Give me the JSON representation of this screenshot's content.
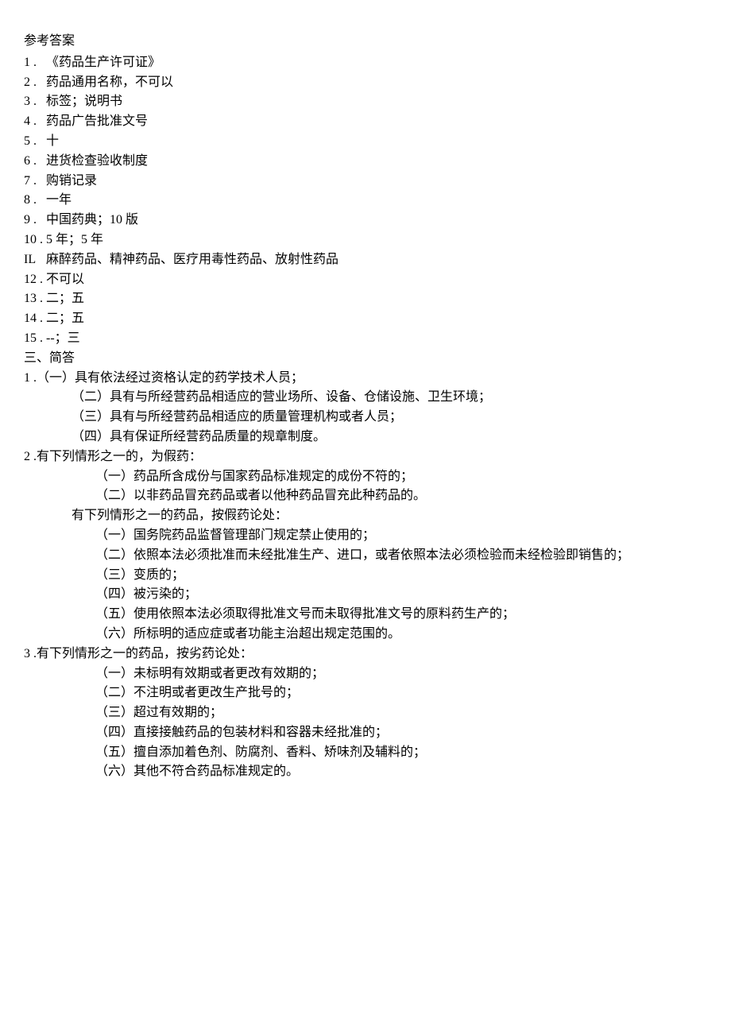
{
  "title": "参考答案",
  "answers": [
    {
      "n": "1",
      "sep": " .",
      "t": "《药品生产许可证》"
    },
    {
      "n": "2",
      "sep": " .",
      "t": "药品通用名称，不可以"
    },
    {
      "n": "3",
      "sep": " .",
      "t": "标签；说明书"
    },
    {
      "n": "4",
      "sep": " .",
      "t": "药品广告批准文号"
    },
    {
      "n": "5",
      "sep": " .",
      "t": "十"
    },
    {
      "n": "6",
      "sep": " .",
      "t": "进货检查验收制度"
    },
    {
      "n": "7",
      "sep": " .",
      "t": "购销记录"
    },
    {
      "n": "8",
      "sep": " .",
      "t": "一年"
    },
    {
      "n": "9",
      "sep": " .",
      "t": "中国药典；10 版"
    },
    {
      "n": "10",
      "sep": " .",
      "t": "5 年；5 年"
    },
    {
      "n": "IL",
      "sep": "",
      "t": " 麻醉药品、精神药品、医疗用毒性药品、放射性药品"
    },
    {
      "n": "12",
      "sep": " .",
      "t": "不可以"
    },
    {
      "n": "13",
      "sep": " .",
      "t": "二；五"
    },
    {
      "n": "14",
      "sep": " .",
      "t": "二；五"
    },
    {
      "n": "15",
      "sep": " .",
      "t": "--；三"
    }
  ],
  "section3_heading": "三、简答",
  "q1": {
    "num": "1",
    "sep": " .",
    "a": "（一）具有依法经过资格认定的药学技术人员；",
    "b": "（二）具有与所经营药品相适应的营业场所、设备、仓储设施、卫生环境；",
    "c": "（三）具有与所经营药品相适应的质量管理机构或者人员；",
    "d": "（四）具有保证所经营药品质量的规章制度。"
  },
  "q2": {
    "num": "2",
    "sep": " .",
    "lead": "有下列情形之一的，为假药：",
    "a": "（一）药品所含成份与国家药品标准规定的成份不符的；",
    "b": "（二）以非药品冒充药品或者以他种药品冒充此种药品的。",
    "mid": "有下列情形之一的药品，按假药论处：",
    "c": "（一）国务院药品监督管理部门规定禁止使用的；",
    "d": "（二）依照本法必须批准而未经批准生产、进口，或者依照本法必须检验而未经检验即销售的；",
    "e": "（三）变质的；",
    "f": "（四）被污染的；",
    "g": "（五）使用依照本法必须取得批准文号而未取得批准文号的原料药生产的；",
    "h": "（六）所标明的适应症或者功能主治超出规定范围的。"
  },
  "q3": {
    "num": "3",
    "sep": " .",
    "lead": "有下列情形之一的药品，按劣药论处：",
    "a": "（一）未标明有效期或者更改有效期的；",
    "b": "（二）不注明或者更改生产批号的；",
    "c": "（三）超过有效期的；",
    "d": "（四）直接接触药品的包装材料和容器未经批准的；",
    "e": "（五）擅自添加着色剂、防腐剂、香料、矫味剂及辅料的；",
    "f": "（六）其他不符合药品标准规定的。"
  }
}
